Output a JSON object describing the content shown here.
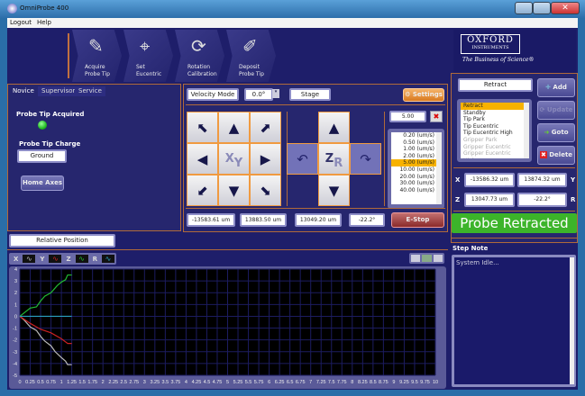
{
  "window": {
    "title": "OmniProbe 400"
  },
  "menu": [
    "Logout",
    "Help"
  ],
  "toolbar": [
    {
      "label1": "Acquire",
      "label2": "Probe Tip",
      "icon": "probe-tip-icon"
    },
    {
      "label1": "Set",
      "label2": "Eucentric",
      "icon": "crosshair-icon"
    },
    {
      "label1": "Rotation",
      "label2": "Calibration",
      "icon": "rotation-icon"
    },
    {
      "label1": "Deposit",
      "label2": "Probe Tip",
      "icon": "deposit-icon"
    }
  ],
  "logo": {
    "name": "OXFORD",
    "sub": "INSTRUMENTS",
    "tagline": "The Business of Science®"
  },
  "tabs": [
    "Novice",
    "Supervisor",
    "Service"
  ],
  "novice": {
    "acquired_label": "Probe Tip Acquired",
    "acquired_color": "#33cc33",
    "charge_label": "Probe Tip Charge",
    "charge_value": "Ground",
    "home_axes": "Home Axes"
  },
  "controls": {
    "mode": "Velocity Mode",
    "angle": "0.0°",
    "target": "Stage",
    "settings": "Settings",
    "speed": "5.00",
    "speeds": [
      "0.20 (um/s)",
      "0.50 (um/s)",
      "1.00 (um/s)",
      "2.00 (um/s)",
      "5.00 (um/s)",
      "10.00 (um/s)",
      "20.00 (um/s)",
      "30.00 (um/s)",
      "40.00 (um/s)"
    ],
    "speed_selected": 4,
    "xy_label": [
      "X",
      "Y"
    ],
    "zr_label": [
      "Z",
      "R"
    ],
    "pos": [
      "-13583.61 um",
      "13883.50 um",
      "13049.20 um",
      "-22.2°"
    ],
    "estop": "E-Stop"
  },
  "relative_position": "Relative Position",
  "legend": [
    {
      "name": "X",
      "color": "#bbbbbb"
    },
    {
      "name": "Y",
      "color": "#cc2222"
    },
    {
      "name": "Z",
      "color": "#22bb33"
    },
    {
      "name": "R",
      "color": "#2aa0c0"
    }
  ],
  "chart_data": {
    "type": "line",
    "xlim": [
      0,
      10
    ],
    "ylim": [
      -5,
      4
    ],
    "xstep": 0.25,
    "ystep": 1,
    "grid": true,
    "series": [
      {
        "name": "X",
        "color": "#bbbbbb",
        "x": [
          0,
          0.1,
          0.25,
          0.4,
          0.5,
          0.6,
          0.75,
          0.85,
          1.0,
          1.1,
          1.15,
          1.25
        ],
        "y": [
          0,
          -0.3,
          -0.9,
          -1.2,
          -1.7,
          -2.1,
          -2.5,
          -3.0,
          -3.5,
          -3.8,
          -4.1,
          -4.1
        ]
      },
      {
        "name": "Y",
        "color": "#cc2222",
        "x": [
          0,
          0.25,
          0.4,
          0.5,
          0.75,
          1.0,
          1.15,
          1.25
        ],
        "y": [
          0,
          -0.6,
          -0.9,
          -1.1,
          -1.4,
          -1.9,
          -2.3,
          -2.3
        ]
      },
      {
        "name": "Z",
        "color": "#22bb33",
        "x": [
          0,
          0.25,
          0.4,
          0.5,
          0.6,
          0.75,
          0.9,
          1.0,
          1.1,
          1.15,
          1.25
        ],
        "y": [
          0,
          0.7,
          0.8,
          1.3,
          1.7,
          2.0,
          2.6,
          2.9,
          3.1,
          3.5,
          3.5
        ]
      },
      {
        "name": "R",
        "color": "#2aa0c0",
        "x": [
          0,
          1.25
        ],
        "y": [
          0,
          0
        ]
      }
    ]
  },
  "positions": {
    "name": "Retract",
    "list": [
      "Retract",
      "Standby",
      "Tip Park",
      "Tip Eucentric",
      "Tip Eucentric High",
      "Gripper Park",
      "Gripper Eucentric",
      "Gripper Eucentric High"
    ],
    "selected": 0,
    "disabled_from": 5,
    "add": "Add",
    "update": "Update",
    "goto": "Goto",
    "delete": "Delete",
    "x": "-13586.32 um",
    "y": "13874.32 um",
    "z": "13047.73 um",
    "r": "-22.2°",
    "labels": [
      "X",
      "Y",
      "Z",
      "R"
    ]
  },
  "status": {
    "text": "Probe Retracted",
    "color": "#3cb42a"
  },
  "step_note": {
    "label": "Step Note",
    "text": "System Idle..."
  }
}
